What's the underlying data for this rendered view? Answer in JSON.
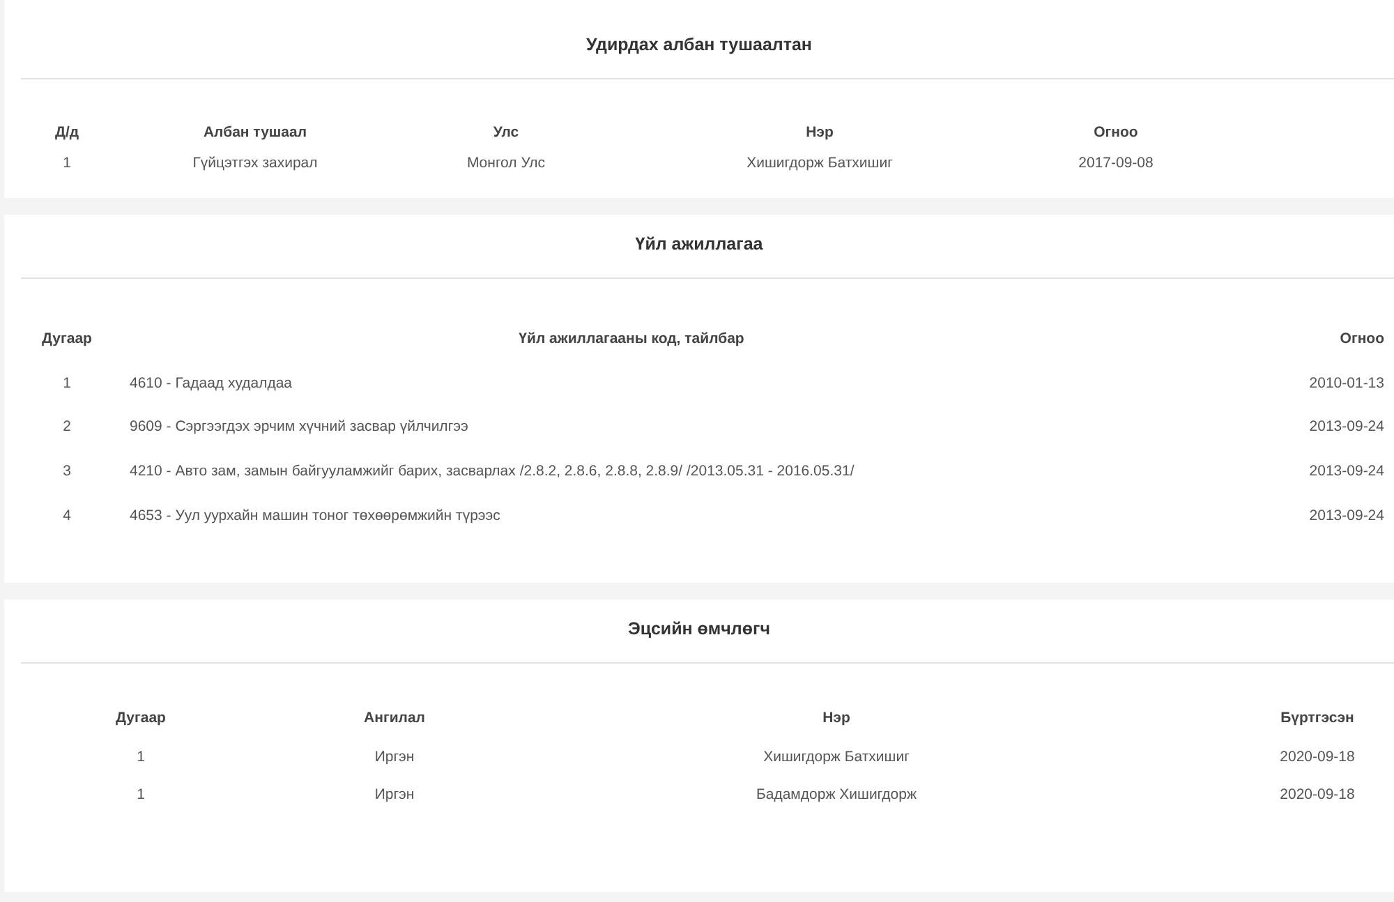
{
  "sections": [
    {
      "title": "Удирдах албан тушаалтан",
      "columns": [
        "Д/д",
        "Албан тушаал",
        "Улс",
        "Нэр",
        "Огноо"
      ],
      "rows": [
        [
          "1",
          "Гүйцэтгэх захирал",
          "Монгол Улс",
          "Хишигдорж Батхишиг",
          "2017-09-08"
        ]
      ]
    },
    {
      "title": "Үйл ажиллагаа",
      "columns": [
        "Дугаар",
        "Үйл ажиллагааны код, тайлбар",
        "Огноо"
      ],
      "rows": [
        [
          "1",
          "4610 - Гадаад худалдаа",
          "2010-01-13"
        ],
        [
          "2",
          "9609 - Сэргээгдэх эрчим хүчний засвар үйлчилгээ",
          "2013-09-24"
        ],
        [
          "3",
          "4210 - Авто зам, замын байгууламжийг барих, засварлах /2.8.2, 2.8.6, 2.8.8, 2.8.9/ /2013.05.31 - 2016.05.31/",
          "2013-09-24"
        ],
        [
          "4",
          "4653 - Уул уурхайн машин тоног төхөөрөмжийн түрээс",
          "2013-09-24"
        ]
      ]
    },
    {
      "title": "Эцсийн өмчлөгч",
      "columns": [
        "Дугаар",
        "Ангилал",
        "Нэр",
        "Бүртгэсэн"
      ],
      "rows": [
        [
          "1",
          "Иргэн",
          "Хишигдорж Батхишиг",
          "2020-09-18"
        ],
        [
          "1",
          "Иргэн",
          "Бадамдорж Хишигдорж",
          "2020-09-18"
        ]
      ]
    }
  ]
}
